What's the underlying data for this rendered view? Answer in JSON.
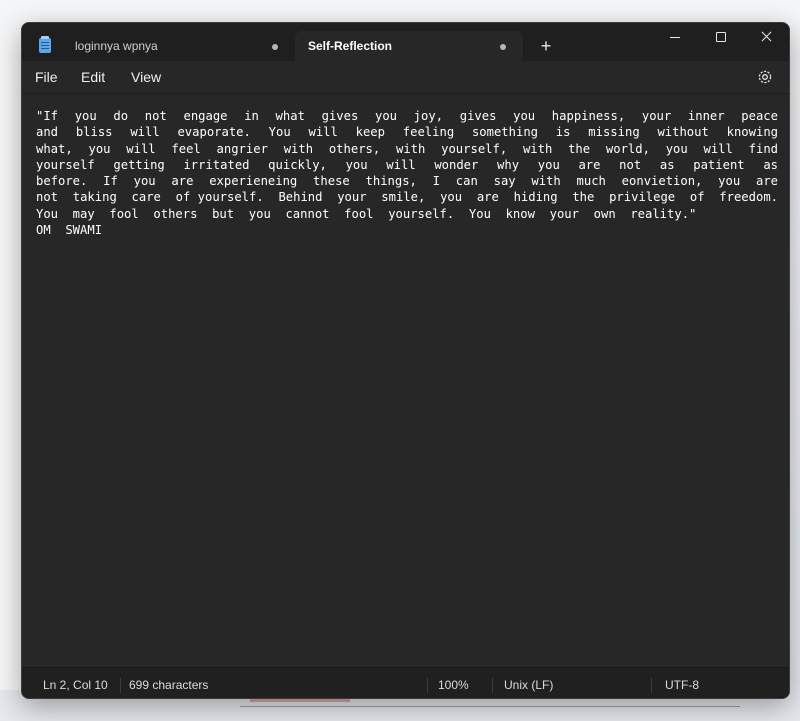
{
  "window": {
    "tabs": [
      {
        "label": "loginnya wpnya",
        "active": false,
        "unsaved_marker": true
      },
      {
        "label": "Self-Reflection",
        "active": true,
        "unsaved_marker": true
      }
    ],
    "new_tab_label": "+",
    "controls": {
      "minimize": "minimize-icon",
      "maximize": "maximize-icon",
      "close": "close-icon"
    }
  },
  "menu": {
    "file": "File",
    "edit": "Edit",
    "view": "View",
    "settings_icon": "gear-icon"
  },
  "document": {
    "content": "\"If  you  do  not  engage  in  what  gives  you  joy,  gives  you  happiness,  your  inner  peace  and  bliss  will  evaporate.  You  will  keep  feeling  something  is  missing  without  knowing  what,  you  will  feel  angrier  with  others,  with  yourself,  with  the  world,  you  will  find  yourself  getting  irritated  quickly,  you  will  wonder  why  you  are  not  as  patient  as  before.  If  you  are  experieneing  these  things,  I  can  say  with  much  eonvietion,  you  are  not  taking  care  of yourself.  Behind  your  smile,  you  are  hiding  the  privilege  of  freedom.  You  may  fool  others  but  you  cannot  fool  yourself.  You  know  your  own  reality.\"\nOM  SWAMI"
  },
  "status": {
    "position": "Ln 2, Col 10",
    "characters": "699 characters",
    "zoom": "100%",
    "line_ending": "Unix (LF)",
    "encoding": "UTF-8"
  },
  "colors": {
    "editor_bg": "#272727",
    "titlebar_bg": "#1f1f1f",
    "statusbar_bg": "#202020",
    "text": "#ffffff"
  }
}
